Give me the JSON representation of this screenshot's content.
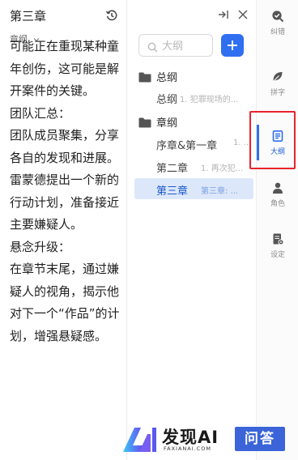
{
  "editor": {
    "chapter_title": "第三章",
    "subtitle": "章纲",
    "paragraphs": [
      "可能正在重现某种童年创伤，这可能是解开案件的关键。",
      "团队汇总：",
      "团队成员聚集，分享各自的发现和进展。雷蒙德提出一个新的行动计划，准备接近主要嫌疑人。",
      "悬念升级：",
      "在章节末尾，通过嫌疑人的视角，揭示他对下一个“作品”的计划，增强悬疑感。"
    ]
  },
  "outline": {
    "search_placeholder": "大纲",
    "groups": [
      {
        "label": "总纲",
        "items": [
          {
            "title": "总纲",
            "desc": "1. 犯罪现场的..."
          }
        ]
      },
      {
        "label": "章纲",
        "items": [
          {
            "title": "序章&第一章",
            "desc": "1. ..."
          },
          {
            "title": "第二章",
            "desc": "1. 再次犯..."
          },
          {
            "title": "第三章",
            "desc": "第三章: ..."
          }
        ]
      }
    ],
    "active_item": "第三章"
  },
  "rail": {
    "items": [
      {
        "label": "纠错",
        "icon": "search-check-icon"
      },
      {
        "label": "拼字",
        "icon": "leaf-icon"
      },
      {
        "label": "大纲",
        "icon": "outline-doc-icon"
      },
      {
        "label": "角色",
        "icon": "person-icon"
      },
      {
        "label": "设定",
        "icon": "settings-doc-icon"
      }
    ],
    "active": "大纲"
  },
  "watermark": {
    "brand": "发现AI",
    "domain": "FAXIANAI.COM",
    "badge": "问答"
  },
  "colors": {
    "accent": "#2f6ff0",
    "highlight": "#e8232b",
    "active_row_bg": "#dce8fa",
    "watermark_badge": "#3a64d8"
  }
}
